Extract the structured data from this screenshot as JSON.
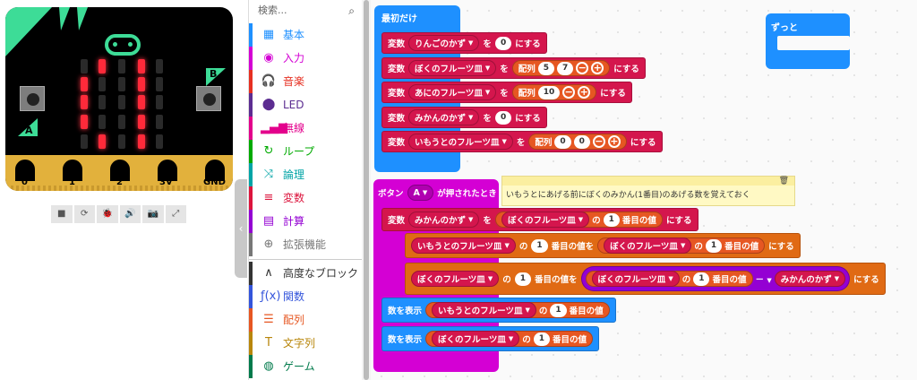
{
  "simulator": {
    "buttons": [
      "A",
      "B"
    ],
    "pins": [
      "0",
      "1",
      "2",
      "3V",
      "GND"
    ],
    "controls": [
      "■",
      "⟳",
      "🐞",
      "🔊",
      "📷",
      "⤢"
    ],
    "led_grid": [
      [
        0,
        1,
        0,
        1,
        0
      ],
      [
        1,
        0,
        0,
        1,
        0
      ],
      [
        1,
        0,
        0,
        1,
        0
      ],
      [
        1,
        0,
        0,
        1,
        0
      ],
      [
        0,
        1,
        0,
        1,
        0
      ]
    ]
  },
  "toolbox": {
    "search_placeholder": "検索...",
    "categories": [
      {
        "label": "基本",
        "color": "#1e90ff",
        "icon": "grid-icon",
        "glyph": "▦"
      },
      {
        "label": "入力",
        "color": "#d400d4",
        "icon": "radio-icon",
        "glyph": "◉"
      },
      {
        "label": "音楽",
        "color": "#e63022",
        "icon": "headphones-icon",
        "glyph": "🎧"
      },
      {
        "label": "LED",
        "color": "#5c2d91",
        "icon": "toggle-icon",
        "glyph": "⬤"
      },
      {
        "label": "無線",
        "color": "#e3008c",
        "icon": "signal-icon",
        "glyph": "▂▄▆"
      },
      {
        "label": "ループ",
        "color": "#00aa00",
        "icon": "loop-icon",
        "glyph": "↻"
      },
      {
        "label": "論理",
        "color": "#00a4a6",
        "icon": "shuffle-icon",
        "glyph": "⤨"
      },
      {
        "label": "変数",
        "color": "#dc143c",
        "icon": "list-icon",
        "glyph": "≡"
      },
      {
        "label": "計算",
        "color": "#9400d3",
        "icon": "calculator-icon",
        "glyph": "▤"
      },
      {
        "label": "拡張機能",
        "color": "#777777",
        "icon": "plus-icon",
        "glyph": "⊕"
      },
      {
        "label": "高度なブロック",
        "color": "#333333",
        "icon": "chevron-up-icon",
        "glyph": "∧"
      },
      {
        "label": "関数",
        "color": "#3455db",
        "icon": "function-icon",
        "glyph": "ƒ(x)"
      },
      {
        "label": "配列",
        "color": "#e65722",
        "icon": "array-icon",
        "glyph": "☰"
      },
      {
        "label": "文字列",
        "color": "#b8860b",
        "icon": "text-icon",
        "glyph": "T"
      },
      {
        "label": "ゲーム",
        "color": "#007a4b",
        "icon": "gamepad-icon",
        "glyph": "◍"
      }
    ]
  },
  "workspace": {
    "on_start": {
      "label": "最初だけ",
      "rows": [
        {
          "kind": "set",
          "var": "りんごのかず",
          "to": "を",
          "value": "0",
          "end": "にする"
        },
        {
          "kind": "array",
          "var": "ぼくのフルーツ皿",
          "to": "を",
          "array_label": "配列",
          "values": [
            "5",
            "7"
          ],
          "end": "にする"
        },
        {
          "kind": "array",
          "var": "あにのフルーツ皿",
          "to": "を",
          "array_label": "配列",
          "values": [
            "10"
          ],
          "end": "にする"
        },
        {
          "kind": "set",
          "var": "みかんのかず",
          "to": "を",
          "value": "0",
          "end": "にする"
        },
        {
          "kind": "array",
          "var": "いもうとのフルーツ皿",
          "to": "を",
          "array_label": "配列",
          "values": [
            "0",
            "0"
          ],
          "end": "にする"
        }
      ]
    },
    "forever": {
      "label": "ずっと"
    },
    "button_event": {
      "prefix": "ボタン",
      "button": "A",
      "suffix": "が押されたとき",
      "comment": "いもうとにあげる前にぼくのみかん(1番目)のあげる数を覚えておく",
      "row1": {
        "label": "変数",
        "var": "みかんのかず",
        "to": "を",
        "arr": "ぼくのフルーツ皿",
        "of": "の",
        "idx": "1",
        "item": "番目の値",
        "end": "にする"
      },
      "row2": {
        "arr": "いもうとのフルーツ皿",
        "of": "の",
        "idx": "1",
        "item": "番目の値を",
        "src_arr": "ぼくのフルーツ皿",
        "src_of": "の",
        "src_idx": "1",
        "src_item": "番目の値",
        "end": "にする"
      },
      "row3": {
        "arr": "ぼくのフルーツ皿",
        "of": "の",
        "idx": "1",
        "item": "番目の値を",
        "src_arr": "ぼくのフルーツ皿",
        "src_of": "の",
        "src_idx": "1",
        "src_item": "番目の値",
        "op": "－",
        "var": "みかんのかず",
        "end": "にする"
      },
      "show1": {
        "label": "数を表示",
        "arr": "いもうとのフルーツ皿",
        "of": "の",
        "idx": "1",
        "item": "番目の値"
      },
      "show2": {
        "label": "数を表示",
        "arr": "ぼくのフルーツ皿",
        "of": "の",
        "idx": "1",
        "item": "番目の値"
      }
    },
    "set_label": "変数"
  }
}
